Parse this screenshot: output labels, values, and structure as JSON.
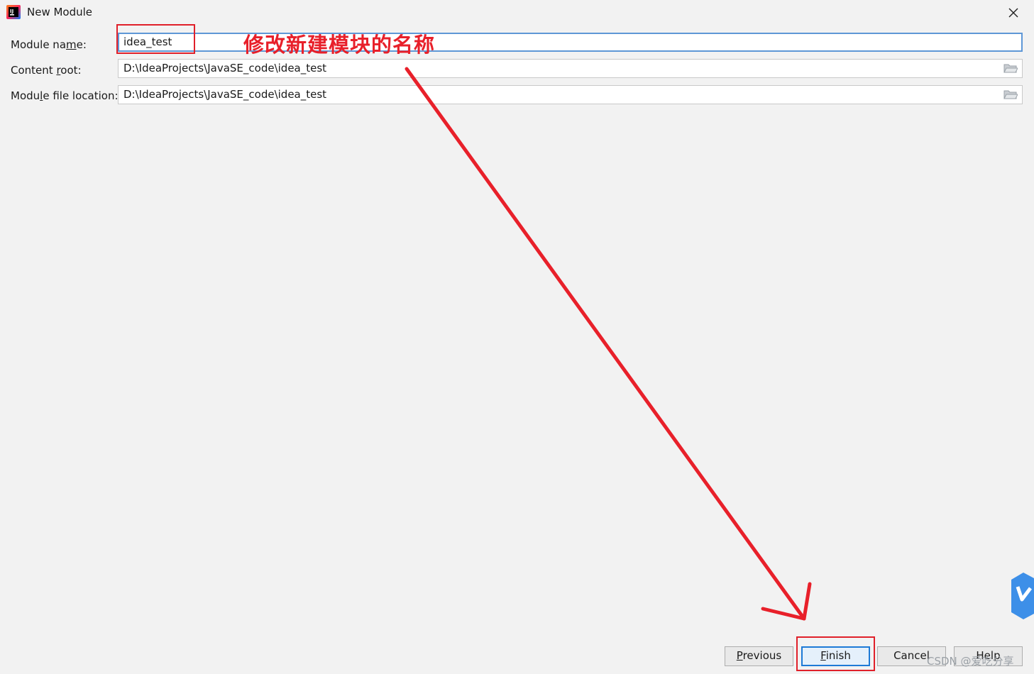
{
  "window": {
    "title": "New Module",
    "icon": "intellij-idea-icon",
    "close_icon": "close-icon"
  },
  "form": {
    "module_name": {
      "label_pre": "Module na",
      "label_mnemonic": "m",
      "label_post": "e:",
      "value": "idea_test"
    },
    "content_root": {
      "label_pre": "Content ",
      "label_mnemonic": "r",
      "label_post": "oot:",
      "value": "D:\\IdeaProjects\\JavaSE_code\\idea_test",
      "browse_icon": "folder-icon"
    },
    "module_file_location": {
      "label_pre": "Modu",
      "label_mnemonic": "l",
      "label_post": "e file location:",
      "value": "D:\\IdeaProjects\\JavaSE_code\\idea_test",
      "browse_icon": "folder-icon"
    }
  },
  "annotation": {
    "text": "修改新建模块的名称",
    "color": "#e8202a"
  },
  "buttons": {
    "previous": {
      "mnemonic": "P",
      "rest": "revious"
    },
    "finish": {
      "mnemonic": "F",
      "rest": "inish"
    },
    "cancel": {
      "label": "Cancel"
    },
    "help": {
      "label": "Help"
    }
  },
  "watermark": "CSDN @爱吃分享",
  "colors": {
    "background": "#f2f2f2",
    "focus_border": "#5e97d6",
    "default_button_border": "#1e7ad6",
    "annotation_red": "#e8202a"
  }
}
